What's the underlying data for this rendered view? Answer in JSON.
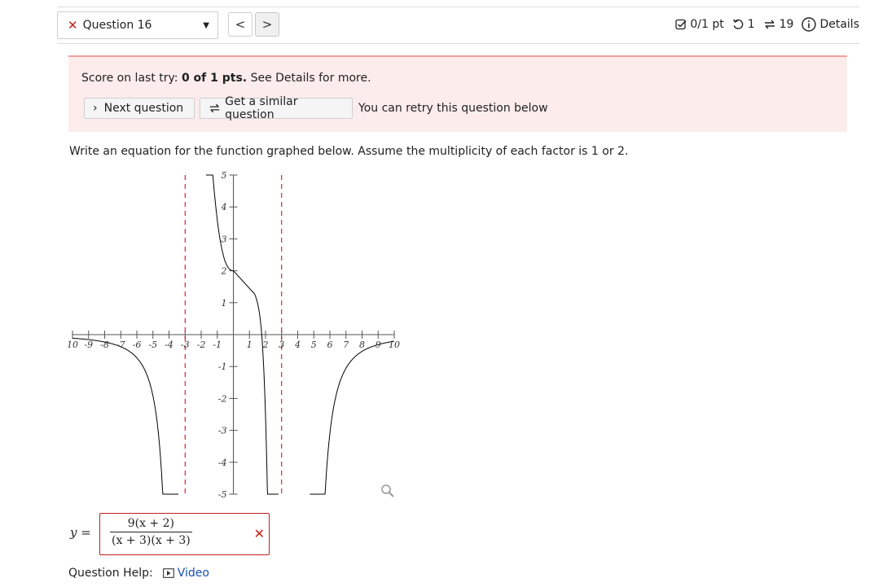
{
  "question_nav": {
    "question_label": "Question 16",
    "prev_glyph": "<",
    "next_glyph": ">"
  },
  "stats": {
    "points": "0/1 pt",
    "retries": "1",
    "similar": "19",
    "details": "Details"
  },
  "alert": {
    "score_prefix": "Score on last try: ",
    "score_value": "0 of 1 pts.",
    "score_suffix": " See Details for more.",
    "next_question": "Next question",
    "similar_question": "Get a similar question",
    "retry_text": "You can retry this question below"
  },
  "prompt": "Write an equation for the function graphed below. Assume the multiplicity of each factor is 1 or 2.",
  "chart_data": {
    "type": "line",
    "xlim": [
      -10,
      10
    ],
    "ylim": [
      -5,
      5
    ],
    "x_ticks": [
      "10",
      "-9",
      "-8",
      "-7",
      "-6",
      "-5",
      "-4",
      "-3",
      "-2",
      "-1",
      "1",
      "2",
      "3",
      "4",
      "5",
      "6",
      "7",
      "8",
      "9",
      "10"
    ],
    "y_ticks": [
      "5",
      "4",
      "3",
      "2",
      "1",
      "-1",
      "-2",
      "-3",
      "-4",
      "-5"
    ],
    "asymptotes_x": [
      -3,
      3
    ],
    "asymptote_color": "#cc0000",
    "curve_color": "#000000",
    "x_intercept": 2,
    "y_intercept": 2,
    "grid": false
  },
  "answer": {
    "label": "y =",
    "numerator": "9(x + 2)",
    "denominator": "(x + 3)(x + 3)",
    "status": "incorrect"
  },
  "help": {
    "label": "Question Help:",
    "video": "Video"
  },
  "colors": {
    "error": "#c0201b",
    "alert_bg": "#fdecec",
    "link": "#1a4fb5"
  }
}
